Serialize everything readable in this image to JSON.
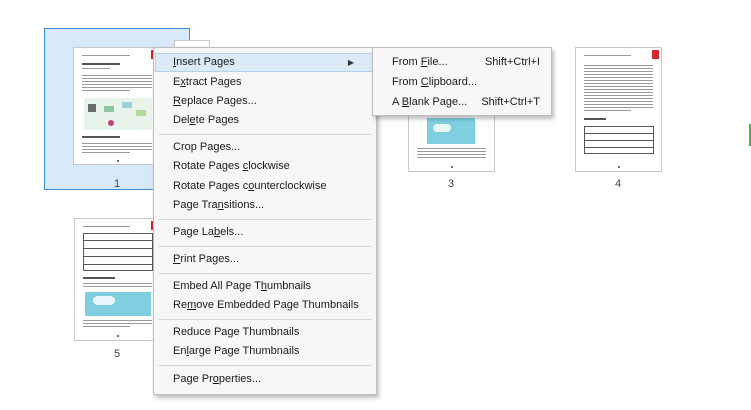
{
  "thumbnails": [
    {
      "label": "1",
      "selected": true
    },
    {
      "label": "3",
      "selected": false
    },
    {
      "label": "4",
      "selected": false
    },
    {
      "label": "5",
      "selected": false
    }
  ],
  "context_menu": {
    "items": [
      {
        "pre": "",
        "u": "I",
        "post": "nsert Pages",
        "submenu": true,
        "highlighted": true
      },
      {
        "pre": "E",
        "u": "x",
        "post": "tract Pages"
      },
      {
        "pre": "",
        "u": "R",
        "post": "eplace Pages..."
      },
      {
        "pre": "Del",
        "u": "e",
        "post": "te Pages"
      },
      {
        "pre": "Crop Pa",
        "u": "g",
        "post": "es..."
      },
      {
        "pre": "Rotate Pages ",
        "u": "c",
        "post": "lockwise"
      },
      {
        "pre": "Rotate Pages c",
        "u": "o",
        "post": "unterclockwise"
      },
      {
        "pre": "Page Tra",
        "u": "n",
        "post": "sitions..."
      },
      {
        "pre": "Page La",
        "u": "b",
        "post": "els..."
      },
      {
        "pre": "",
        "u": "P",
        "post": "rint Pages..."
      },
      {
        "pre": "Embed All Page T",
        "u": "h",
        "post": "umbnails"
      },
      {
        "pre": "Re",
        "u": "m",
        "post": "ove Embedded Page Thumbnails"
      },
      {
        "pre": "Reduce Page Thumbnails",
        "u": "",
        "post": ""
      },
      {
        "pre": "En",
        "u": "l",
        "post": "arge Page Thumbnails"
      },
      {
        "pre": "Page Pr",
        "u": "o",
        "post": "perties..."
      }
    ]
  },
  "submenu": {
    "items": [
      {
        "pre": "From ",
        "u": "F",
        "post": "ile...",
        "shortcut": "Shift+Ctrl+I"
      },
      {
        "pre": "From ",
        "u": "C",
        "post": "lipboard...",
        "shortcut": ""
      },
      {
        "pre": "A ",
        "u": "B",
        "post": "lank Page...",
        "shortcut": "Shift+Ctrl+T"
      }
    ]
  }
}
